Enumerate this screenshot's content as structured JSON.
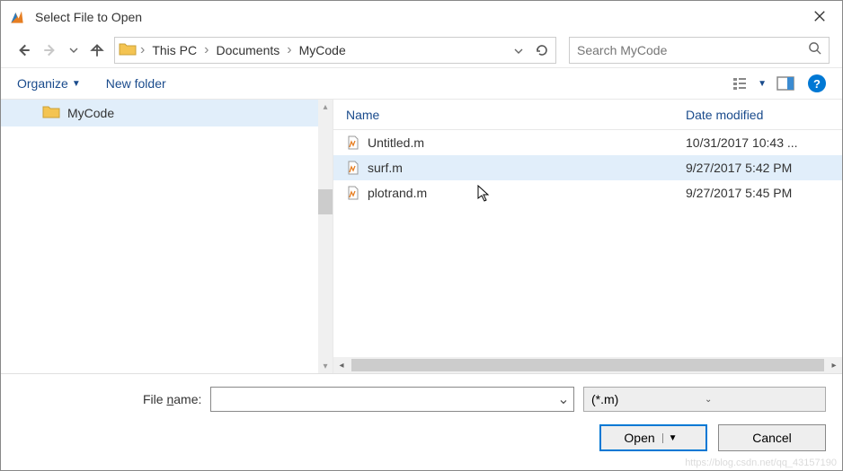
{
  "title": "Select File to Open",
  "breadcrumb": [
    "This PC",
    "Documents",
    "MyCode"
  ],
  "search_placeholder": "Search MyCode",
  "toolbar": {
    "organize": "Organize",
    "newfolder": "New folder"
  },
  "sidebar": {
    "items": [
      {
        "label": "MyCode"
      }
    ]
  },
  "columns": {
    "name": "Name",
    "date": "Date modified"
  },
  "files": [
    {
      "name": "Untitled.m",
      "date": "10/31/2017 10:43 ..."
    },
    {
      "name": "surf.m",
      "date": "9/27/2017 5:42 PM"
    },
    {
      "name": "plotrand.m",
      "date": "9/27/2017 5:45 PM"
    }
  ],
  "filename_label": "File name:",
  "filename_value": "",
  "filter": "(*.m)",
  "buttons": {
    "open": "Open",
    "cancel": "Cancel"
  },
  "help": "?"
}
